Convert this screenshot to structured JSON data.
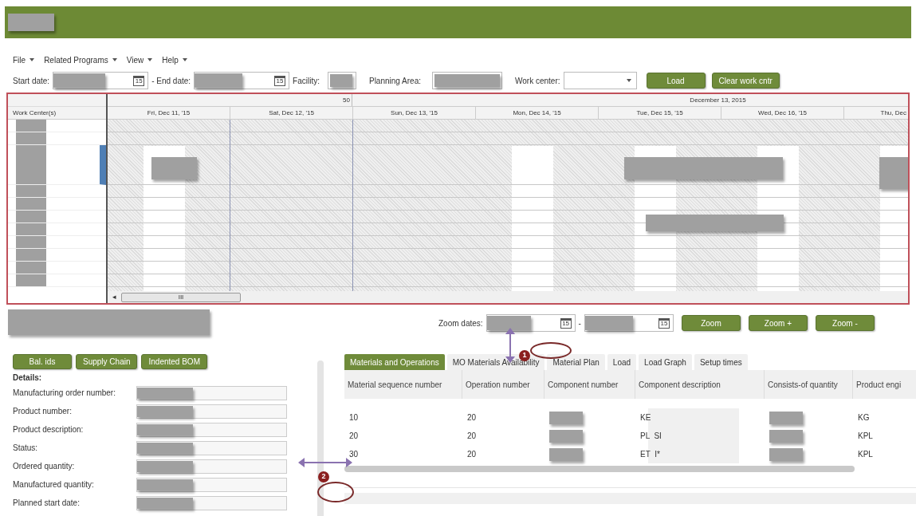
{
  "menu": [
    {
      "label": "File"
    },
    {
      "label": "Related Programs"
    },
    {
      "label": "View"
    },
    {
      "label": "Help"
    }
  ],
  "filters": {
    "start_date_label": "Start date:",
    "end_date_separator": "- End date:",
    "start_calendar_day": "15",
    "end_calendar_day": "15",
    "facility_label": "Facility:",
    "planning_area_label": "Planning Area:",
    "work_center_label": "Work center:",
    "buttons": [
      "Load",
      "Clear work cntr"
    ]
  },
  "gantt": {
    "column_header": "Work Center(s)",
    "week_label": "50",
    "month_label": "December 13, 2015",
    "days": [
      {
        "label": "Fri, Dec 11, '15",
        "working": true
      },
      {
        "label": "Sat, Dec 12, '15",
        "working": false
      },
      {
        "label": "Sun, Dec 13, '15",
        "working": false
      },
      {
        "label": "Mon, Dec 14, '15",
        "working": true
      },
      {
        "label": "Tue, Dec 15, '15",
        "working": true
      },
      {
        "label": "Wed, Dec 16, '15",
        "working": true
      },
      {
        "label": "Thu, Dec",
        "working": true
      }
    ],
    "rows": [
      {
        "selected": false
      },
      {
        "selected": false
      },
      {
        "selected": true
      },
      {
        "selected": false
      },
      {
        "selected": false
      },
      {
        "selected": false
      },
      {
        "selected": false
      },
      {
        "selected": false
      },
      {
        "selected": false
      },
      {
        "selected": false
      },
      {
        "selected": false
      }
    ],
    "scroll_left_arrow": "◂",
    "scroll_grip": "III"
  },
  "zoom": {
    "label": "Zoom dates:",
    "separator": "-",
    "start_calendar_day": "15",
    "end_calendar_day": "15",
    "buttons": [
      "Zoom",
      "Zoom +",
      "Zoom -"
    ]
  },
  "details": {
    "buttons": [
      "Bal. ids",
      "Supply Chain",
      "Indented BOM"
    ],
    "title": "Details:",
    "fields": [
      "Manufacturing order number:",
      "Product number:",
      "Product description:",
      "Status:",
      "Ordered quantity:",
      "Manufactured quantity:",
      "Planned start date:"
    ]
  },
  "tabs": [
    {
      "label": "Materials and Operations",
      "selected": true
    },
    {
      "label": "MO Materials Availability",
      "selected": false
    },
    {
      "label": "Material Plan",
      "selected": false
    },
    {
      "label": "Load",
      "selected": false
    },
    {
      "label": "Load Graph",
      "selected": false
    },
    {
      "label": "Setup times",
      "selected": false
    }
  ],
  "table": {
    "columns": [
      "Material sequence number",
      "Operation number",
      "Component number",
      "Component description",
      "Consists-of quantity",
      "Product engi"
    ],
    "rows": [
      [
        "10",
        "20",
        "",
        "KE",
        "",
        "KG"
      ],
      [
        "20",
        "20",
        "",
        "PL  SI",
        "",
        "KPL"
      ],
      [
        "30",
        "20",
        "",
        "ET  I*",
        "",
        "KPL"
      ]
    ]
  },
  "annotations": [
    "1",
    "2"
  ]
}
